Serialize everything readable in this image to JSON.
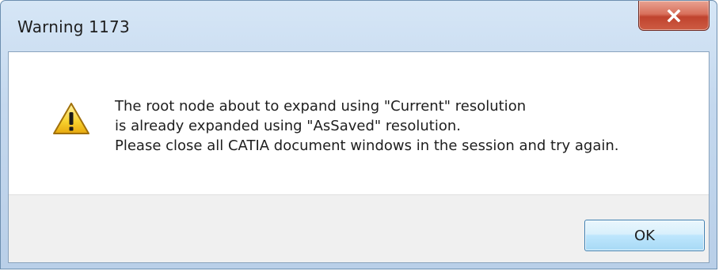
{
  "window": {
    "title": "Warning 1173",
    "close_icon": "close-icon",
    "close_color": "#c7432e"
  },
  "message": {
    "icon": "warning-icon",
    "lines": [
      "The root node about to expand using \"Current\" resolution",
      "is already expanded using \"AsSaved\" resolution.",
      "Please close all CATIA document windows in the session and try again."
    ]
  },
  "buttons": {
    "ok_label": "OK"
  }
}
